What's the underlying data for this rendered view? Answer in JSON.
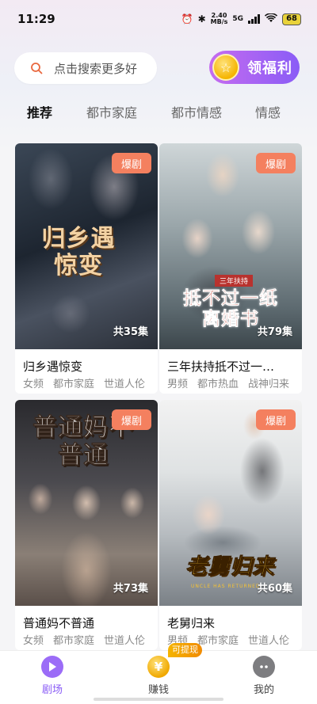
{
  "status": {
    "time": "11:29",
    "net_speed_top": "2.40",
    "net_speed_unit": "MB/s",
    "net_type": "5G",
    "battery": "68"
  },
  "search": {
    "placeholder": "点击搜索更多好"
  },
  "welfare": {
    "label": "领福利",
    "coin_glyph": "☆"
  },
  "tabs": [
    {
      "label": "推荐",
      "active": true
    },
    {
      "label": "都市家庭"
    },
    {
      "label": "都市情感"
    },
    {
      "label": "情感"
    }
  ],
  "cards": [
    {
      "title": "归乡遇惊变",
      "badge": "爆剧",
      "episodes": "共35集",
      "poster_text": "归乡遇惊变",
      "tags": [
        "女频",
        "都市家庭",
        "世道人伦"
      ]
    },
    {
      "title": "三年扶持抵不过一…",
      "badge": "爆剧",
      "episodes": "共79集",
      "poster_text": "抵不过一纸离婚书",
      "poster_sub": "三年扶持",
      "tags": [
        "男频",
        "都市热血",
        "战神归来"
      ]
    },
    {
      "title": "普通妈不普通",
      "badge": "爆剧",
      "episodes": "共73集",
      "poster_text": "普通妈不普通",
      "tags": [
        "女频",
        "都市家庭",
        "世道人伦"
      ]
    },
    {
      "title": "老舅归来",
      "badge": "爆剧",
      "episodes": "共60集",
      "poster_text": "老舅归来",
      "poster_sub": "UNCLE HAS RETURNED",
      "tags": [
        "男频",
        "都市家庭",
        "世道人伦"
      ]
    }
  ],
  "bottom_nav": [
    {
      "label": "剧场",
      "icon": "play-icon",
      "active": true
    },
    {
      "label": "赚钱",
      "icon": "yen-coin-icon",
      "coin_glyph": "¥"
    },
    {
      "label": "我的",
      "icon": "profile-icon"
    }
  ],
  "withdraw_badge": "可提现",
  "colors": {
    "accent": "#8a5cf6",
    "badge": "#f4805f",
    "coin": "#f5b400"
  }
}
